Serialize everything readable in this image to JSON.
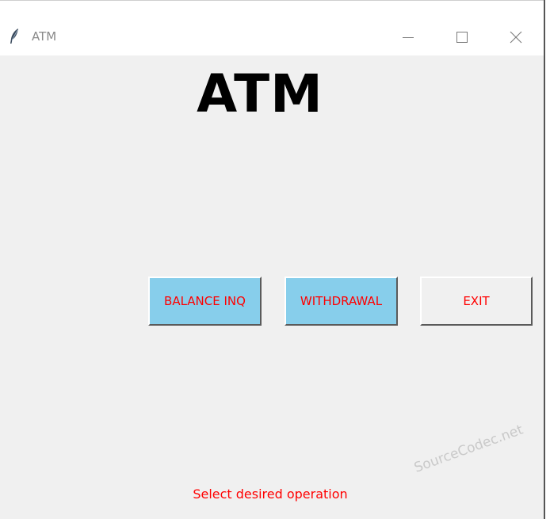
{
  "window": {
    "title": "ATM",
    "icon": "feather-icon",
    "controls": {
      "minimize_icon": "minimize-icon",
      "maximize_icon": "maximize-icon",
      "close_icon": "close-icon"
    }
  },
  "main": {
    "heading": "ATM",
    "buttons": {
      "balance": "BALANCE INQ",
      "withdrawal": "WITHDRAWAL",
      "exit": "EXIT"
    },
    "status": "Select desired operation"
  },
  "watermark": "SourceCodec.net",
  "colors": {
    "window_bg": "#f0f0f0",
    "titlebar_bg": "#ffffff",
    "button_blue": "#87ceeb",
    "button_gray": "#f0f0f0",
    "button_text": "#ff0000",
    "status_text": "#ff0000",
    "heading_text": "#000000"
  }
}
